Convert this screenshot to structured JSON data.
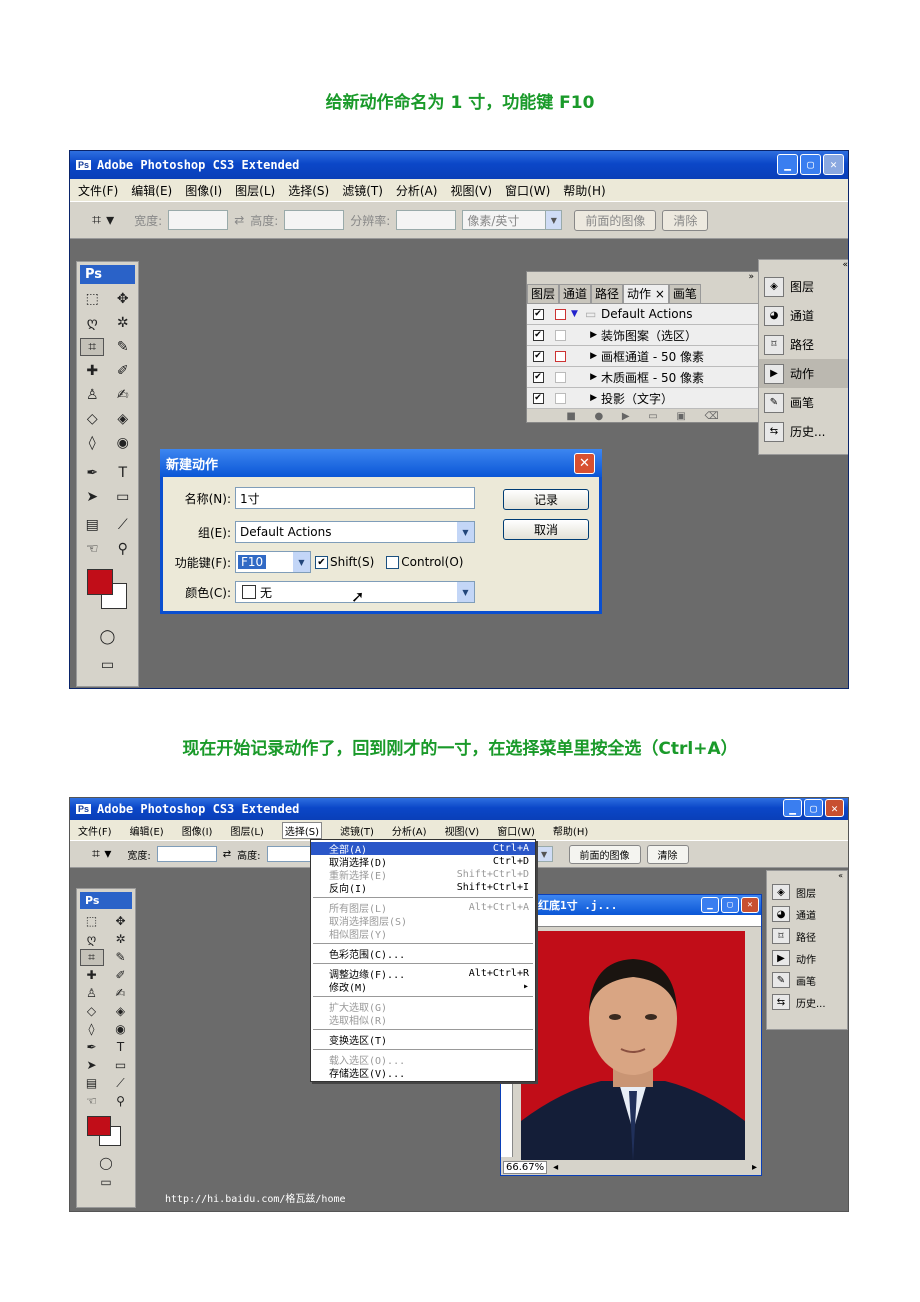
{
  "caption1": "给新动作命名为 1 寸，功能键 F10",
  "caption2": "现在开始记录动作了，回到刚才的一寸，在选择菜单里按全选（Ctrl+A）",
  "app": {
    "title": "Adobe Photoshop CS3 Extended",
    "ps_logo": "Ps",
    "menu": [
      "文件(F)",
      "编辑(E)",
      "图像(I)",
      "图层(L)",
      "选择(S)",
      "滤镜(T)",
      "分析(A)",
      "视图(V)",
      "窗口(W)",
      "帮助(H)"
    ],
    "options": {
      "width_label": "宽度:",
      "height_label": "高度:",
      "resolution_label": "分辨率:",
      "unit": "像素/英寸",
      "front_image": "前面的图像",
      "clear": "清除"
    },
    "panels": [
      "图层",
      "通道",
      "路径",
      "动作",
      "画笔",
      "历史..."
    ]
  },
  "actions_panel": {
    "tabs": [
      "图层",
      "通道",
      "路径",
      "动作 ×",
      "画笔"
    ],
    "set_name": "Default Actions",
    "items": [
      "装饰图案（选区）",
      "画框通道 - 50 像素",
      "木质画框 - 50 像素",
      "投影（文字）"
    ]
  },
  "dialog": {
    "title": "新建动作",
    "name_label": "名称(N):",
    "name_value": "1寸",
    "group_label": "组(E):",
    "group_value": "Default Actions",
    "fkey_label": "功能键(F):",
    "fkey_value": "F10",
    "shift_label": "Shift(S)",
    "control_label": "Control(O)",
    "color_label": "颜色(C):",
    "color_value": "无",
    "record_button": "记录",
    "cancel_button": "取消"
  },
  "select_menu": {
    "items": [
      {
        "label": "全部(A)",
        "shortcut": "Ctrl+A",
        "state": "highlight"
      },
      {
        "label": "取消选择(D)",
        "shortcut": "Ctrl+D",
        "state": "normal"
      },
      {
        "label": "重新选择(E)",
        "shortcut": "Shift+Ctrl+D",
        "state": "disabled"
      },
      {
        "label": "反向(I)",
        "shortcut": "Shift+Ctrl+I",
        "state": "normal"
      },
      {
        "sep": true
      },
      {
        "label": "所有图层(L)",
        "shortcut": "Alt+Ctrl+A",
        "state": "disabled"
      },
      {
        "label": "取消选择图层(S)",
        "shortcut": "",
        "state": "disabled"
      },
      {
        "label": "相似图层(Y)",
        "shortcut": "",
        "state": "disabled"
      },
      {
        "sep": true
      },
      {
        "label": "色彩范围(C)...",
        "shortcut": "",
        "state": "normal"
      },
      {
        "sep": true
      },
      {
        "label": "调整边缘(F)...",
        "shortcut": "Alt+Ctrl+R",
        "state": "normal"
      },
      {
        "label": "修改(M)",
        "shortcut": "▸",
        "state": "normal"
      },
      {
        "sep": true
      },
      {
        "label": "扩大选取(G)",
        "shortcut": "",
        "state": "disabled"
      },
      {
        "label": "选取相似(R)",
        "shortcut": "",
        "state": "disabled"
      },
      {
        "sep": true
      },
      {
        "label": "变换选区(T)",
        "shortcut": "",
        "state": "normal"
      },
      {
        "sep": true
      },
      {
        "label": "载入选区(O)...",
        "shortcut": "",
        "state": "disabled"
      },
      {
        "label": "存储选区(V)...",
        "shortcut": "",
        "state": "normal"
      }
    ]
  },
  "document": {
    "title": "格瓦兹红底1寸 .j...",
    "zoom": "66.67%"
  },
  "watermark": "http://hi.baidu.com/格瓦兹/home"
}
